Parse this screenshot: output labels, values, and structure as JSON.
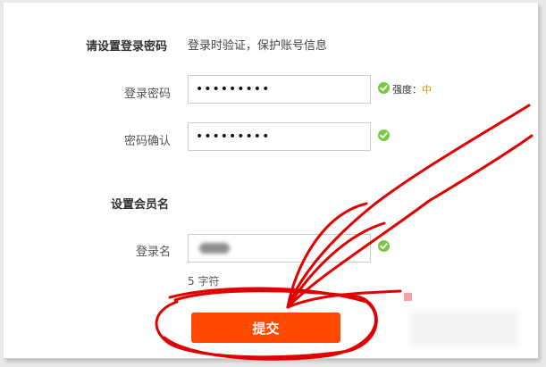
{
  "password_section": {
    "title": "请设置登录密码",
    "hint": "登录时验证，保护账号信息"
  },
  "password_field": {
    "label": "登录密码",
    "value": "•••••••••",
    "strength_label": "强度：",
    "strength_value": "中"
  },
  "confirm_field": {
    "label": "密码确认",
    "value": "•••••••••"
  },
  "member_section": {
    "title": "设置会员名"
  },
  "username_field": {
    "label": "登录名",
    "char_count": "5 字符"
  },
  "submit": {
    "label": "提交"
  },
  "colors": {
    "accent": "#ff4a00",
    "success": "#7ac943",
    "strength_medium": "#f08a00",
    "annotation_red": "#e00000"
  },
  "icons": {
    "valid": "check-circle-icon"
  }
}
